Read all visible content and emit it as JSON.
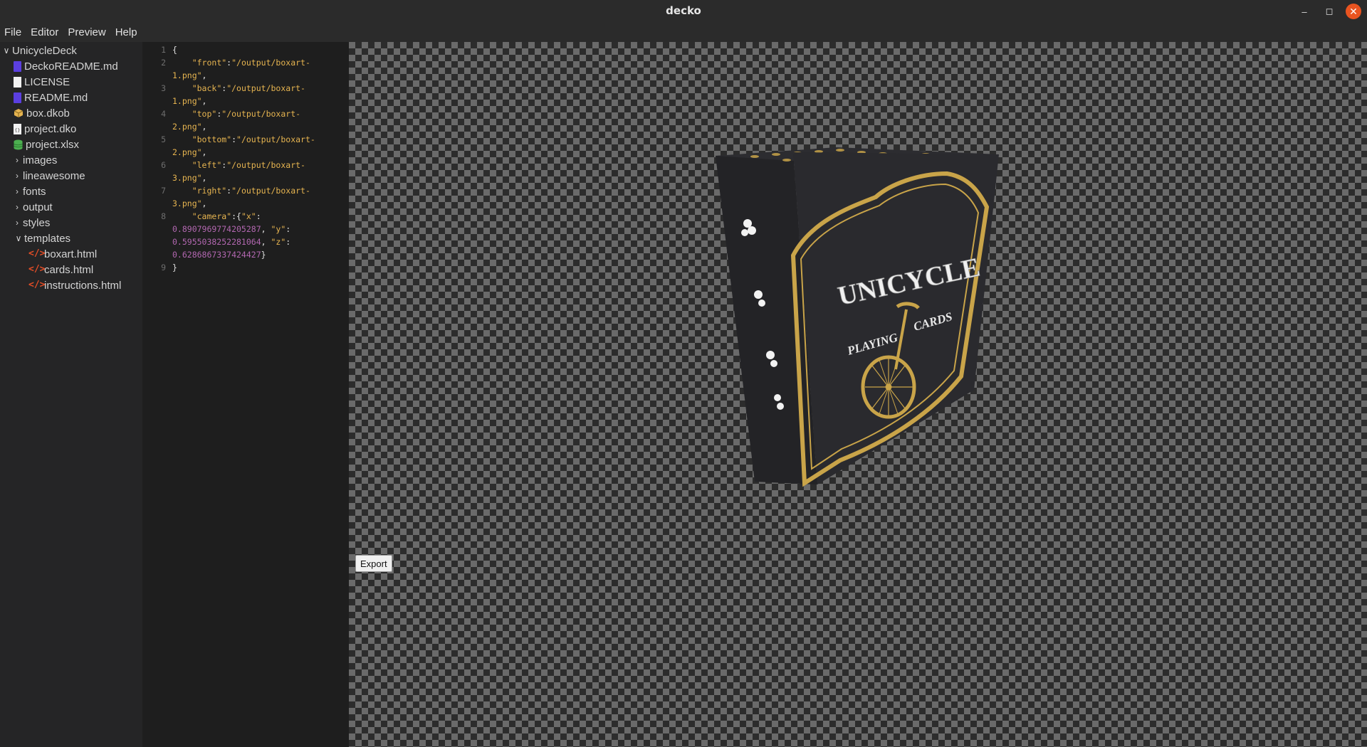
{
  "window": {
    "title": "decko",
    "minimize_glyph": "–",
    "maximize_glyph": "◻",
    "close_glyph": "✕"
  },
  "menu": [
    "File",
    "Editor",
    "Preview",
    "Help"
  ],
  "tree": {
    "root": "UnicycleDeck",
    "files": [
      {
        "name": "DeckoREADME.md",
        "icon": "markdown-file-icon"
      },
      {
        "name": "LICENSE",
        "icon": "text-file-icon"
      },
      {
        "name": "README.md",
        "icon": "markdown-file-icon"
      },
      {
        "name": "box.dkob",
        "icon": "package-box-icon"
      },
      {
        "name": "project.dko",
        "icon": "decko-project-file-icon"
      },
      {
        "name": "project.xlsx",
        "icon": "spreadsheet-file-icon"
      }
    ],
    "folders": [
      "images",
      "lineawesome",
      "fonts",
      "output",
      "styles"
    ],
    "open_folder": "templates",
    "template_files": [
      "boxart.html",
      "cards.html",
      "instructions.html"
    ]
  },
  "editor": {
    "line_numbers": [
      "1",
      "2",
      "3",
      "4",
      "5",
      "6",
      "7",
      "8",
      "9"
    ],
    "open_brace": "{",
    "close_brace": "}",
    "entries": [
      {
        "key": "\"front\"",
        "value_a": "\"/output/boxart-",
        "value_b": "1.png\""
      },
      {
        "key": "\"back\"",
        "value_a": "\"/output/boxart-",
        "value_b": "1.png\""
      },
      {
        "key": "\"top\"",
        "value_a": "\"/output/boxart-",
        "value_b": "2.png\""
      },
      {
        "key": "\"bottom\"",
        "value_a": "\"/output/boxart-",
        "value_b": "2.png\""
      },
      {
        "key": "\"left\"",
        "value_a": "\"/output/boxart-",
        "value_b": "3.png\""
      },
      {
        "key": "\"right\"",
        "value_a": "\"/output/boxart-",
        "value_b": "3.png\""
      }
    ],
    "camera": {
      "key": "\"camera\"",
      "x_key": "\"x\"",
      "x": "0.8907969774205287",
      "y_key": "\"y\"",
      "y": "0.5955038252281064",
      "z_key": "\"z\"",
      "z": "0.6286867337424427"
    }
  },
  "preview": {
    "box_title": "UNICYCLE",
    "box_subtitle_left": "PLAYING",
    "box_subtitle_right": "CARDS",
    "export_label": "Export",
    "colors": {
      "box_dark": "#2a2a2e",
      "gold": "#c9a449",
      "checker_dark": "#2c2c2c",
      "checker_light": "#6a6a6a"
    }
  }
}
